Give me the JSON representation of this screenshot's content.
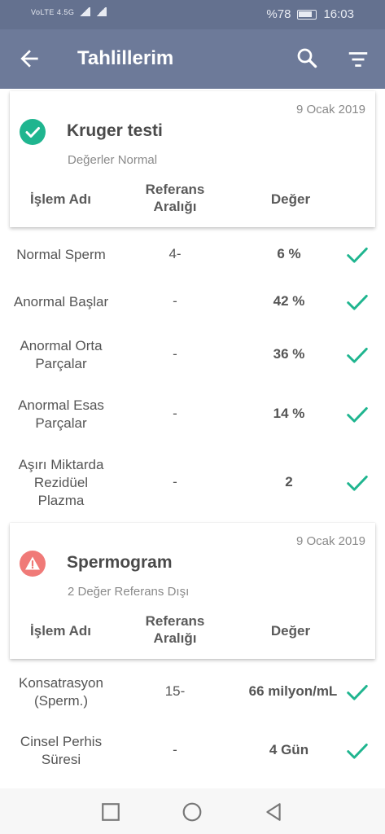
{
  "status_bar": {
    "carrier_left": "VoLTE 4.5G",
    "battery": "%78",
    "time": "16:03"
  },
  "app_bar": {
    "title": "Tahlillerim",
    "icons": [
      "back-arrow-icon",
      "search-icon",
      "filter-icon"
    ]
  },
  "columns": {
    "name": "İşlem Adı",
    "ref": "Referans Aralığı",
    "value": "Değer"
  },
  "tests": [
    {
      "date": "9 Ocak 2019",
      "name": "Kruger testi",
      "summary": "Değerler Normal",
      "status": "normal",
      "status_color": "#1fb58f",
      "rows": [
        {
          "name": "Normal Sperm",
          "ref": "4-",
          "value": "6 %"
        },
        {
          "name": "Anormal Başlar",
          "ref": "-",
          "value": "42 %"
        },
        {
          "name": "Anormal Orta Parçalar",
          "ref": "-",
          "value": "36 %"
        },
        {
          "name": "Anormal Esas Parçalar",
          "ref": "-",
          "value": "14 %"
        },
        {
          "name": "Aşırı Miktarda Rezidüel Plazma",
          "ref": "-",
          "value": "2"
        }
      ]
    },
    {
      "date": "9 Ocak 2019",
      "name": "Spermogram",
      "summary": "2 Değer Referans Dışı",
      "status": "warning",
      "status_color": "#f07a78",
      "rows": [
        {
          "name": "Konsatrasyon (Sperm.)",
          "ref": "15-",
          "value": "66 milyon/mL"
        },
        {
          "name": "Cinsel Perhis Süresi",
          "ref": "-",
          "value": "4 Gün"
        }
      ]
    }
  ],
  "colors": {
    "app_bar": "#6d7a99",
    "status_bar": "#64718f",
    "check": "#1fb58f"
  },
  "nav_bar": [
    "recent-apps-icon",
    "home-icon",
    "back-icon"
  ]
}
